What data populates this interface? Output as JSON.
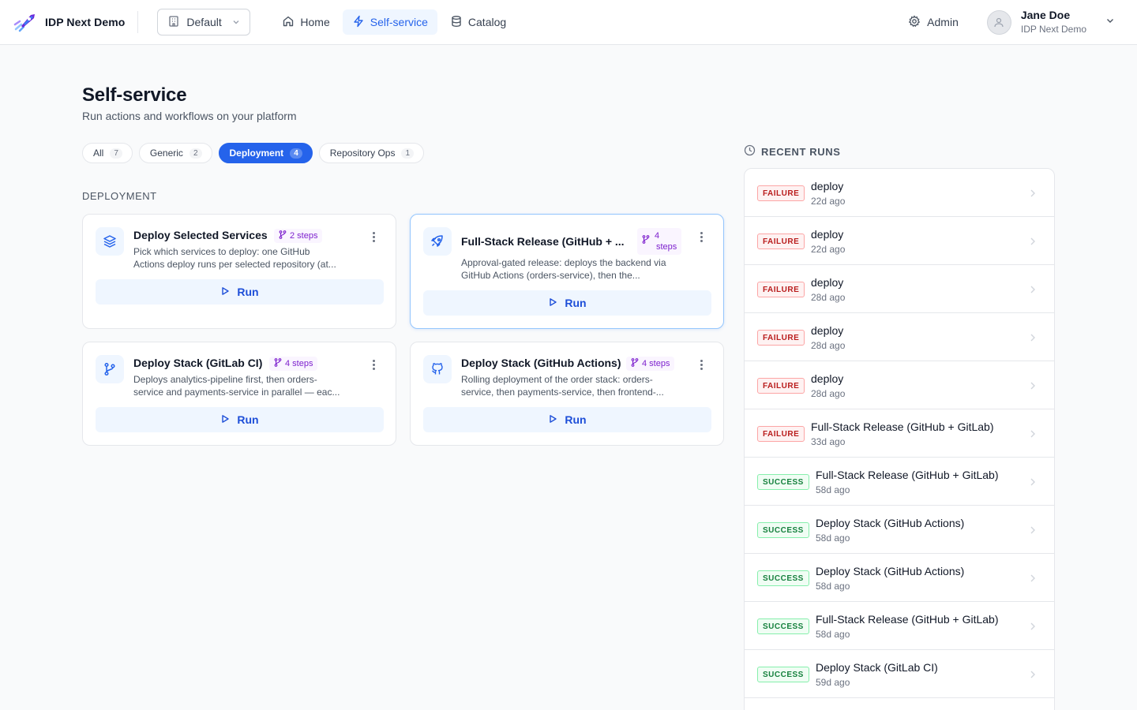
{
  "app": {
    "name": "IDP Next Demo"
  },
  "workspace": {
    "selected": "Default"
  },
  "nav": [
    {
      "label": "Home",
      "icon": "home-icon"
    },
    {
      "label": "Self-service",
      "icon": "lightning-icon",
      "active": true
    },
    {
      "label": "Catalog",
      "icon": "database-icon"
    }
  ],
  "header": {
    "admin_label": "Admin",
    "user": {
      "name": "Jane Doe",
      "org": "IDP Next Demo"
    }
  },
  "page": {
    "title": "Self-service",
    "subtitle": "Run actions and workflows on your platform"
  },
  "filters": [
    {
      "label": "All",
      "count": "7"
    },
    {
      "label": "Generic",
      "count": "2"
    },
    {
      "label": "Deployment",
      "count": "4",
      "active": true
    },
    {
      "label": "Repository Ops",
      "count": "1"
    }
  ],
  "section": {
    "label": "DEPLOYMENT"
  },
  "cards": [
    {
      "title": "Deploy Selected Services",
      "steps": "2 steps",
      "icon": "layers-icon",
      "desc1": "Pick which services to deploy: one GitHub",
      "desc2": "Actions deploy runs per selected repository (at...",
      "run_label": "Run"
    },
    {
      "title": "Full-Stack Release (GitHub + ...",
      "steps_num": "4",
      "steps_word": "steps",
      "icon": "rocket-icon",
      "desc1": "Approval-gated release: deploys the backend via",
      "desc2": "GitHub Actions (orders-service), then the...",
      "run_label": "Run"
    },
    {
      "title": "Deploy Stack (GitLab CI)",
      "steps": "4 steps",
      "icon": "git-branch-icon",
      "desc1": "Deploys analytics-pipeline first, then orders-",
      "desc2": "service and payments-service in parallel — eac...",
      "run_label": "Run"
    },
    {
      "title": "Deploy Stack (GitHub Actions)",
      "steps": "4 steps",
      "icon": "github-icon",
      "desc1": "Rolling deployment of the order stack: orders-",
      "desc2": "service, then payments-service, then frontend-...",
      "run_label": "Run"
    }
  ],
  "recent_runs": {
    "title": "RECENT RUNS",
    "items": [
      {
        "status": "FAILURE",
        "name": "deploy",
        "time": "22d ago"
      },
      {
        "status": "FAILURE",
        "name": "deploy",
        "time": "22d ago"
      },
      {
        "status": "FAILURE",
        "name": "deploy",
        "time": "28d ago"
      },
      {
        "status": "FAILURE",
        "name": "deploy",
        "time": "28d ago"
      },
      {
        "status": "FAILURE",
        "name": "deploy",
        "time": "28d ago"
      },
      {
        "status": "FAILURE",
        "name": "Full-Stack Release (GitHub + GitLab)",
        "time": "33d ago"
      },
      {
        "status": "SUCCESS",
        "name": "Full-Stack Release (GitHub + GitLab)",
        "time": "58d ago"
      },
      {
        "status": "SUCCESS",
        "name": "Deploy Stack (GitHub Actions)",
        "time": "58d ago"
      },
      {
        "status": "SUCCESS",
        "name": "Deploy Stack (GitHub Actions)",
        "time": "58d ago"
      },
      {
        "status": "SUCCESS",
        "name": "Full-Stack Release (GitHub + GitLab)",
        "time": "58d ago"
      },
      {
        "status": "SUCCESS",
        "name": "Deploy Stack (GitLab CI)",
        "time": "59d ago"
      }
    ]
  },
  "colors": {
    "accent": "#2563eb",
    "failure": "#b91c1c",
    "success": "#15803d",
    "steps": "#7e22ce"
  }
}
